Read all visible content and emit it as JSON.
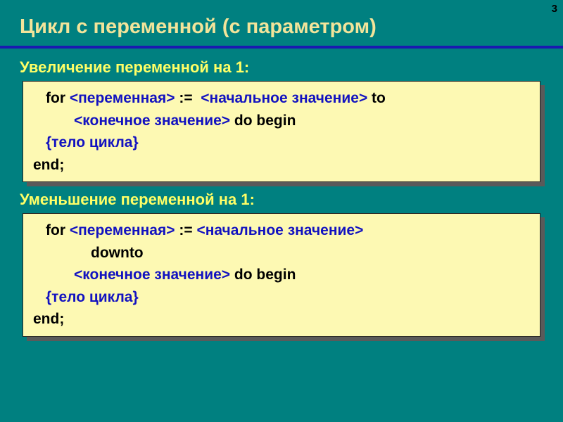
{
  "pageNumber": "3",
  "title": "Цикл с переменной (с параметром)",
  "section1": {
    "label": "Увеличение переменной на 1:"
  },
  "section2": {
    "label": "Уменьшение переменной на 1:"
  },
  "code1": {
    "for": "for",
    "var": "<переменная>",
    "assign": ":=",
    "start": "<начальное значение>",
    "to": "to",
    "end": "<конечное значение>",
    "doBegin": "do begin",
    "body": "{тело цикла}",
    "endkw": "end;"
  },
  "code2": {
    "for": "for",
    "var": "<переменная>",
    "assign": ":=",
    "start": "<начальное значение>",
    "downto": "downto",
    "end": "<конечное значение>",
    "doBegin": "do begin",
    "body": "{тело цикла}",
    "endkw": "end;"
  }
}
